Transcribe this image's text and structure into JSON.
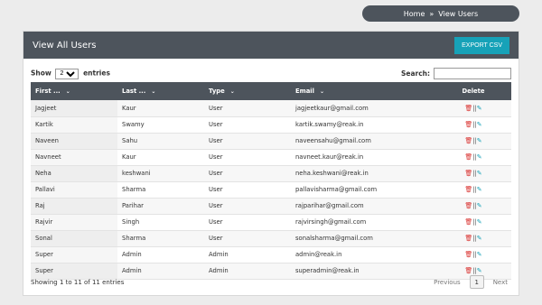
{
  "breadcrumb": {
    "home": "Home",
    "separator": "»",
    "current": "View Users"
  },
  "panel": {
    "title": "View All Users",
    "export_label": "EXPORT CSV"
  },
  "controls": {
    "show_label": "Show",
    "entries_value": "25",
    "entries_label": "entries",
    "search_label": "Search:",
    "search_value": ""
  },
  "table": {
    "headers": [
      "First ...",
      "Last ...",
      "Type",
      "Email",
      "Delete"
    ],
    "rows": [
      {
        "first": "Jagjeet",
        "last": "Kaur",
        "type": "User",
        "email": "jagjeetkaur@gmail.com"
      },
      {
        "first": "Kartik",
        "last": "Swamy",
        "type": "User",
        "email": "kartik.swamy@reak.in"
      },
      {
        "first": "Naveen",
        "last": "Sahu",
        "type": "User",
        "email": "naveensahu@gmail.com"
      },
      {
        "first": "Navneet",
        "last": "Kaur",
        "type": "User",
        "email": "navneet.kaur@reak.in"
      },
      {
        "first": "Neha",
        "last": "keshwani",
        "type": "User",
        "email": "neha.keshwani@reak.in"
      },
      {
        "first": "Pallavi",
        "last": "Sharma",
        "type": "User",
        "email": "pallavisharma@gmail.com"
      },
      {
        "first": "Raj",
        "last": "Parihar",
        "type": "User",
        "email": "rajparihar@gmail.com"
      },
      {
        "first": "Rajvir",
        "last": "Singh",
        "type": "User",
        "email": "rajvirsingh@gmail.com"
      },
      {
        "first": "Sonal",
        "last": "Sharma",
        "type": "User",
        "email": "sonalsharma@gmail.com"
      },
      {
        "first": "Super",
        "last": "Admin",
        "type": "Admin",
        "email": "admin@reak.in"
      },
      {
        "first": "Super",
        "last": "Admin",
        "type": "Admin",
        "email": "superadmin@reak.in"
      }
    ],
    "delete_separator": "||"
  },
  "footer": {
    "info": "Showing 1 to 11 of 11 entries",
    "previous": "Previous",
    "page": "1",
    "next": "Next"
  },
  "icons": {
    "sort": "chevron-down-icon",
    "delete": "trash-icon",
    "edit": "edit-icon"
  },
  "colors": {
    "header_bg": "#4d545c",
    "accent": "#17a2b8",
    "delete_red": "#d9302e"
  }
}
